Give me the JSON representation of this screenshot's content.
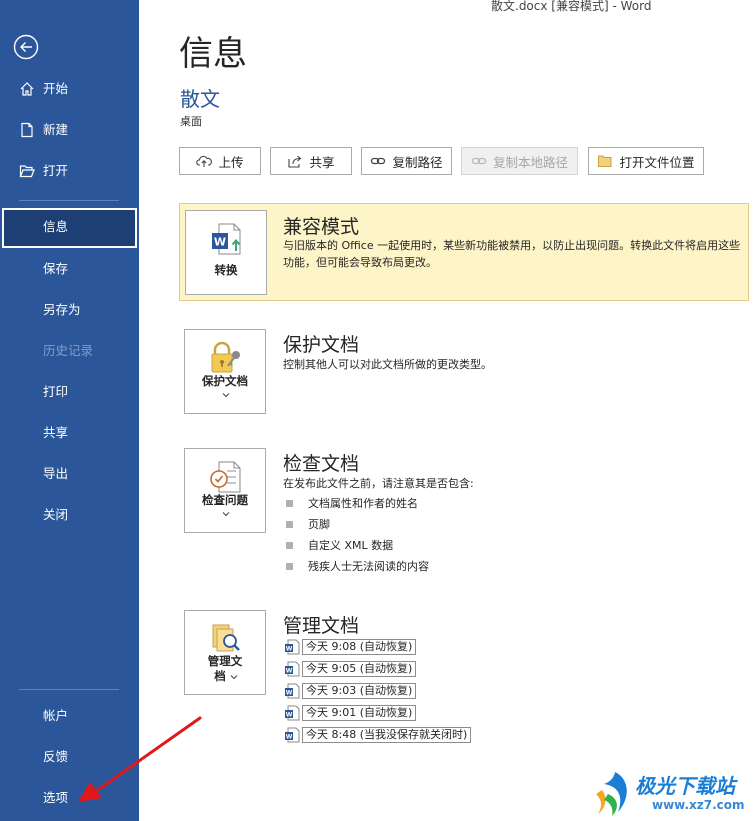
{
  "window": {
    "title": "散文.docx [兼容模式]  -  Word"
  },
  "sidebar": {
    "items": [
      {
        "label": "开始"
      },
      {
        "label": "新建"
      },
      {
        "label": "打开"
      },
      {
        "label": "信息"
      },
      {
        "label": "保存"
      },
      {
        "label": "另存为"
      },
      {
        "label": "历史记录"
      },
      {
        "label": "打印"
      },
      {
        "label": "共享"
      },
      {
        "label": "导出"
      },
      {
        "label": "关闭"
      }
    ],
    "bottom_items": [
      {
        "label": "帐户"
      },
      {
        "label": "反馈"
      },
      {
        "label": "选项"
      }
    ],
    "colors": {
      "background": "#2b579a",
      "selected": "#1e3f73"
    }
  },
  "main": {
    "title": "信息",
    "document_name": "散文",
    "document_location": "桌面",
    "toolbar": {
      "upload": "上传",
      "share": "共享",
      "copy_path": "复制路径",
      "copy_local_path": "复制本地路径",
      "open_location": "打开文件位置"
    },
    "compatibility": {
      "button_label": "转换",
      "title": "兼容模式",
      "description": "与旧版本的 Office 一起使用时，某些新功能被禁用，以防止出现问题。转换此文件将启用这些功能，但可能会导致布局更改。",
      "background": "#fdf4c8"
    },
    "protect": {
      "button_label": "保护文档",
      "title": "保护文档",
      "description": "控制其他人可以对此文档所做的更改类型。"
    },
    "inspect": {
      "button_label": "检查问题",
      "title": "检查文档",
      "description": "在发布此文件之前，请注意其是否包含:",
      "items": [
        "文档属性和作者的姓名",
        "页脚",
        "自定义 XML 数据",
        "残疾人士无法阅读的内容"
      ]
    },
    "manage": {
      "button_label_line1": "管理文",
      "button_label_line2": "档",
      "title": "管理文档",
      "versions": [
        "今天 9:08 (自动恢复)",
        "今天 9:05 (自动恢复)",
        "今天 9:03 (自动恢复)",
        "今天 9:01 (自动恢复)",
        "今天 8:48 (当我没保存就关闭时)"
      ]
    }
  },
  "watermark": {
    "title": "极光下载站",
    "url": "www.xz7.com"
  }
}
